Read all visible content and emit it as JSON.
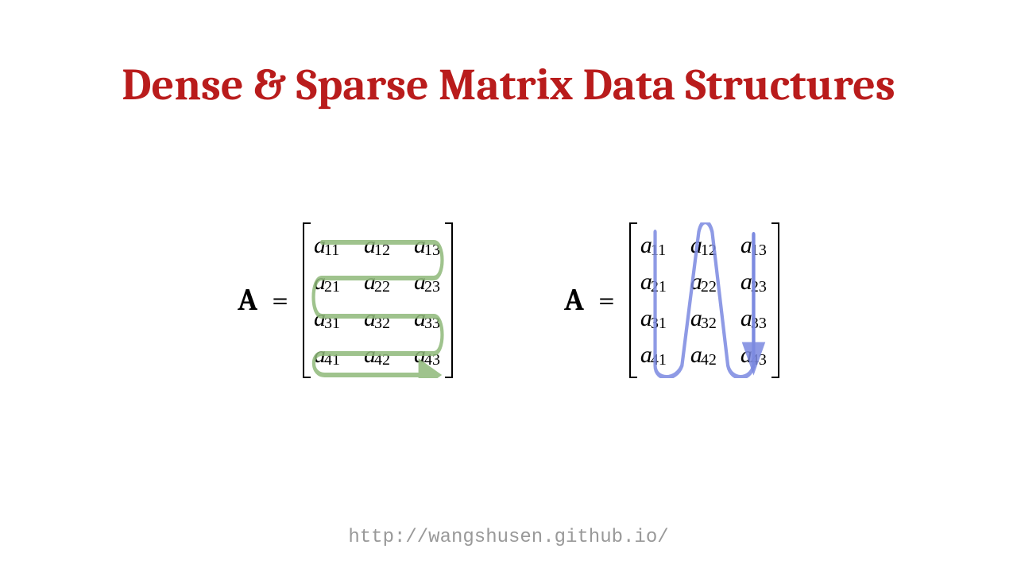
{
  "title": "Dense & Sparse Matrix Data Structures",
  "footer_url": "http://wangshusen.github.io/",
  "label": "A",
  "equals": "=",
  "matrix": {
    "rows": 4,
    "cols": 3,
    "cells": [
      {
        "base": "a",
        "sub": "11"
      },
      {
        "base": "a",
        "sub": "12"
      },
      {
        "base": "a",
        "sub": "13"
      },
      {
        "base": "a",
        "sub": "21"
      },
      {
        "base": "a",
        "sub": "22"
      },
      {
        "base": "a",
        "sub": "23"
      },
      {
        "base": "a",
        "sub": "31"
      },
      {
        "base": "a",
        "sub": "32"
      },
      {
        "base": "a",
        "sub": "33"
      },
      {
        "base": "a",
        "sub": "41"
      },
      {
        "base": "a",
        "sub": "42"
      },
      {
        "base": "a",
        "sub": "43"
      }
    ]
  },
  "traversals": {
    "left": {
      "order": "row-major",
      "color": "#8fb97a"
    },
    "right": {
      "order": "column-major",
      "color": "#7a88e0"
    }
  }
}
